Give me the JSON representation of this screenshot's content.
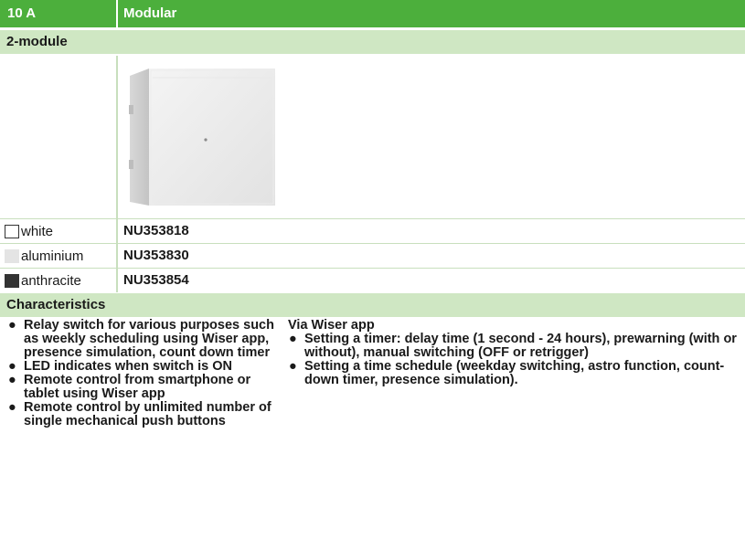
{
  "header": {
    "col1": "10 A",
    "col2": "Modular"
  },
  "subheader": {
    "label": "2-module"
  },
  "variants": [
    {
      "color_name": "white",
      "swatch": "#ffffff",
      "swatch_border": "#333333",
      "ref": "NU353818"
    },
    {
      "color_name": "aluminium",
      "swatch": "#e4e4e4",
      "swatch_border": "#e4e4e4",
      "ref": "NU353830"
    },
    {
      "color_name": "anthracite",
      "swatch": "#333333",
      "swatch_border": "#333333",
      "ref": "NU353854"
    }
  ],
  "characteristics": {
    "title": "Characteristics",
    "left_items": [
      "Relay switch for various purposes such as weekly scheduling using Wiser app, presence simulation, count down timer",
      "LED indicates when switch is ON",
      "Remote control from smartphone or tablet using Wiser app",
      "Remote control by unlimited number of single mechanical push buttons"
    ],
    "right_intro": "Via Wiser app",
    "right_items": [
      "Setting a timer: delay time (1 second - 24 hours), prewarning (with or without), manual switching (OFF or retrigger)",
      "Setting a time schedule (weekday switching, astro function, count-down timer, presence simulation)."
    ]
  },
  "colors": {
    "header_green": "#4caf3c",
    "band_green": "#cfe7c3"
  }
}
